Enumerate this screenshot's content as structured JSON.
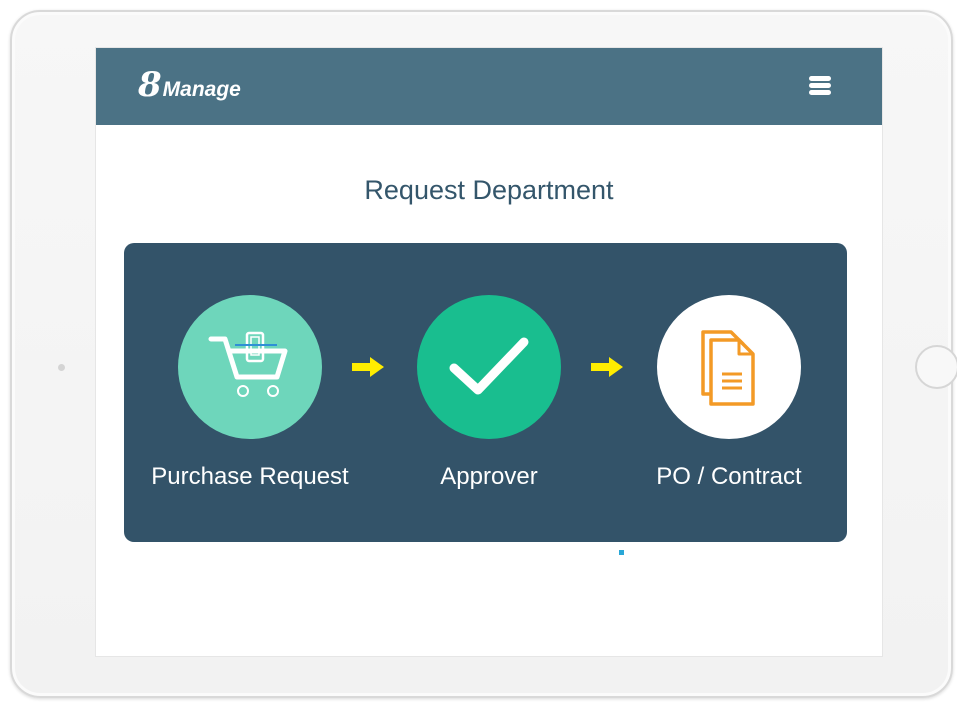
{
  "header": {
    "logo_number": "8",
    "logo_text": "Manage",
    "menu_icon": "hamburger-menu-icon"
  },
  "page": {
    "title": "Request Department"
  },
  "flow": {
    "steps": [
      {
        "label": "Purchase Request",
        "icon": "shopping-cart-icon",
        "circle_color": "#6ed6bb"
      },
      {
        "label": "Approver",
        "icon": "checkmark-icon",
        "circle_color": "#19be8f"
      },
      {
        "label": "PO / Contract",
        "icon": "documents-icon",
        "circle_color": "#ffffff"
      }
    ],
    "arrow_color": "#ffed00",
    "panel_color": "#335369"
  },
  "colors": {
    "header_bar": "#4b7285",
    "title_text": "#34566b",
    "document_icon": "#f39a26"
  }
}
